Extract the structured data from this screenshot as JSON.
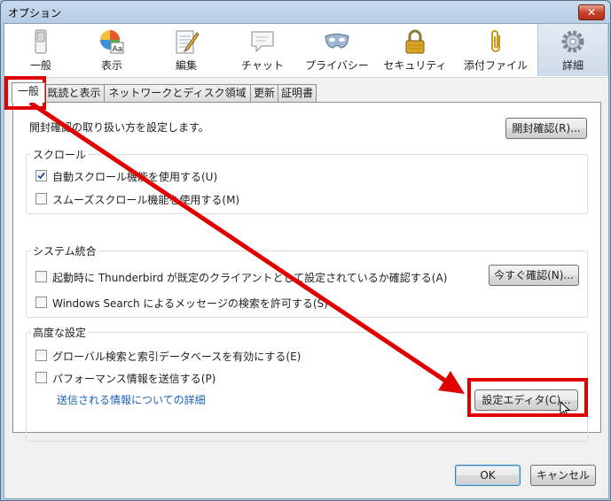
{
  "window": {
    "title": "オプション",
    "close_label": "✕"
  },
  "toolbar": [
    {
      "label": "一般",
      "icon": "switch-icon"
    },
    {
      "label": "表示",
      "icon": "color-palette-icon"
    },
    {
      "label": "編集",
      "icon": "notepad-icon"
    },
    {
      "label": "チャット",
      "icon": "speech-bubble-icon"
    },
    {
      "label": "プライバシー",
      "icon": "mask-icon"
    },
    {
      "label": "セキュリティ",
      "icon": "padlock-icon"
    },
    {
      "label": "添付ファイル",
      "icon": "paperclip-icon"
    },
    {
      "label": "詳細",
      "icon": "gear-icon",
      "selected": true
    }
  ],
  "tabs": [
    {
      "label": "一般",
      "active": true
    },
    {
      "label": "既読と表示"
    },
    {
      "label": "ネットワークとディスク領域"
    },
    {
      "label": "更新"
    },
    {
      "label": "証明書"
    }
  ],
  "general": {
    "receipt_text": "開封確認の取り扱い方を設定します。",
    "receipt_button": "開封確認(R)..."
  },
  "scroll": {
    "title": "スクロール",
    "auto_scroll": {
      "label": "自動スクロール機能を使用する(U)",
      "checked": true
    },
    "smooth_scroll": {
      "label": "スムーズスクロール機能を使用する(M)",
      "checked": false
    }
  },
  "system": {
    "title": "システム統合",
    "default_client": {
      "label": "起動時に Thunderbird が既定のクライアントとして設定されているか確認する(A)",
      "checked": false
    },
    "check_now_button": "今すぐ確認(N)...",
    "windows_search": {
      "label": "Windows Search によるメッセージの検索を許可する(S)",
      "checked": false
    }
  },
  "advanced": {
    "title": "高度な設定",
    "global_search": {
      "label": "グローバル検索と索引データベースを有効にする(E)",
      "checked": false
    },
    "performance": {
      "label": "パフォーマンス情報を送信する(P)",
      "checked": false
    },
    "details_link": "送信される情報についての詳細",
    "config_editor_button": "設定エディタ(C)..."
  },
  "footer": {
    "ok_label": "OK",
    "cancel_label": "キャンセル"
  },
  "colors": {
    "highlight": "#e10000",
    "link": "#1a63b8",
    "accent": "#3c7fb1"
  }
}
